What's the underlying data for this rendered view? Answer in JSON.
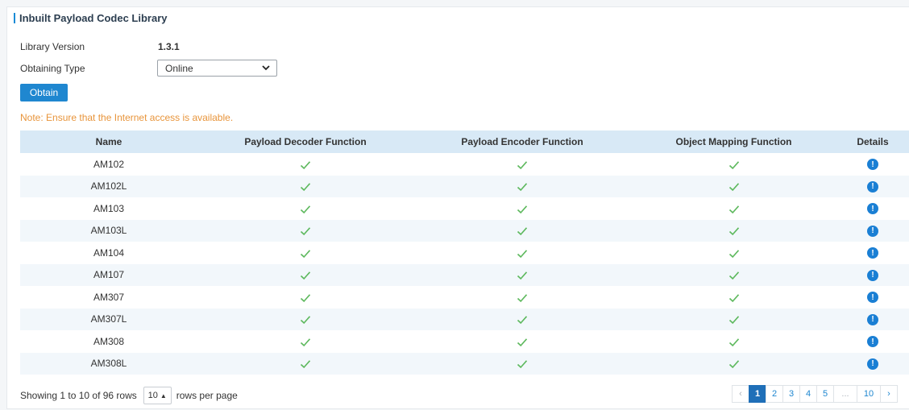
{
  "section": {
    "title": "Inbuilt Payload Codec Library"
  },
  "library": {
    "version_label": "Library Version",
    "version_value": "1.3.1",
    "type_label": "Obtaining Type",
    "type_value": "Online",
    "obtain_button": "Obtain",
    "note": "Note: Ensure that the Internet access is available."
  },
  "table": {
    "headers": [
      "Name",
      "Payload Decoder Function",
      "Payload Encoder Function",
      "Object Mapping Function",
      "Details"
    ],
    "rows": [
      {
        "name": "AM102"
      },
      {
        "name": "AM102L"
      },
      {
        "name": "AM103"
      },
      {
        "name": "AM103L"
      },
      {
        "name": "AM104"
      },
      {
        "name": "AM107"
      },
      {
        "name": "AM307"
      },
      {
        "name": "AM307L"
      },
      {
        "name": "AM308"
      },
      {
        "name": "AM308L"
      }
    ]
  },
  "footer": {
    "showing": "Showing 1 to 10 of 96 rows",
    "rows_per_page_value": "10",
    "rows_per_page_label": "rows per page",
    "pages": [
      "‹",
      "1",
      "2",
      "3",
      "4",
      "5",
      "...",
      "10",
      "›"
    ],
    "active_page": "1"
  },
  "colors": {
    "accent": "#1f87d0",
    "check": "#5cb85c",
    "note": "#e8943a"
  }
}
